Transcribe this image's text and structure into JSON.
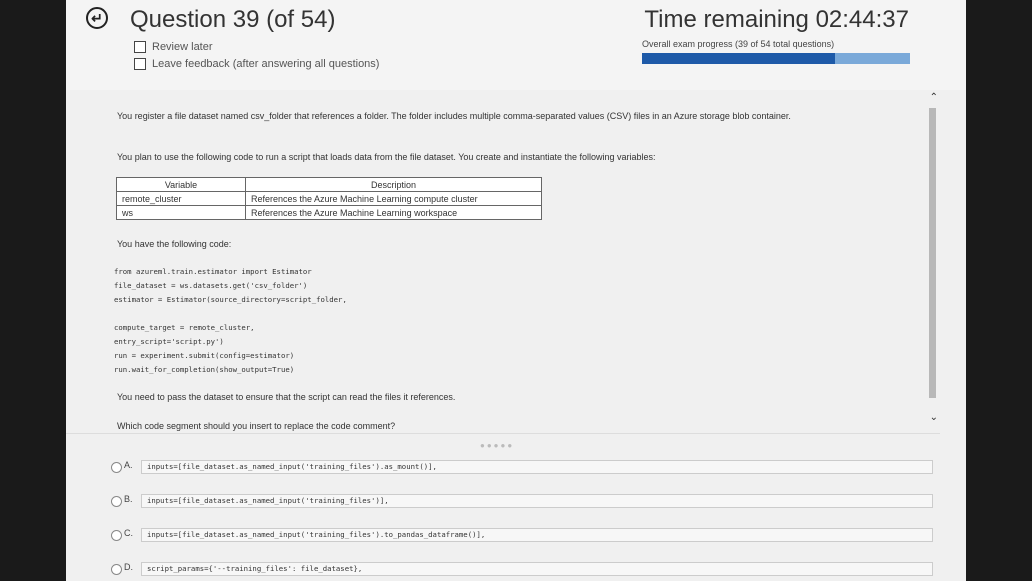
{
  "header": {
    "question_title": "Question 39 (of 54)",
    "review_later": "Review later",
    "leave_feedback": "Leave feedback (after answering all questions)",
    "timer": "Time remaining 02:44:37",
    "progress_label": "Overall exam progress (39 of 54 total questions)",
    "progress_fraction": 0.722
  },
  "question": {
    "para1": "You register a file dataset named csv_folder that references a folder. The folder includes multiple comma-separated values (CSV) files in an Azure storage blob container.",
    "para2": "You plan to use the following code to run a script that loads data from the file dataset. You create and instantiate the following variables:",
    "table": {
      "headers": [
        "Variable",
        "Description"
      ],
      "rows": [
        [
          "remote_cluster",
          "References the Azure Machine Learning compute cluster"
        ],
        [
          "ws",
          "References the Azure Machine Learning workspace"
        ]
      ]
    },
    "para3": "You have the following code:",
    "code_block1": "from azureml.train.estimator import Estimator\nfile_dataset = ws.datasets.get('csv_folder')\nestimator = Estimator(source_directory=script_folder,",
    "code_block2": "compute_target = remote_cluster,\nentry_script='script.py')\nrun = experiment.submit(config=estimator)\nrun.wait_for_completion(show_output=True)",
    "para4": "You need to pass the dataset to ensure that the script can read the files it references.",
    "para5": "Which code segment should you insert to replace the code comment?"
  },
  "options": [
    {
      "letter": "A.",
      "code": "inputs=[file_dataset.as_named_input('training_files').as_mount()],"
    },
    {
      "letter": "B.",
      "code": "inputs=[file_dataset.as_named_input('training_files')],"
    },
    {
      "letter": "C.",
      "code": "inputs=[file_dataset.as_named_input('training_files').to_pandas_dataframe()],"
    },
    {
      "letter": "D.",
      "code": "script_params={'--training_files': file_dataset},"
    }
  ],
  "colors": {
    "progress_fill": "#1e5aa8",
    "progress_track": "#7aa9d9"
  },
  "icons": {
    "back": "back-circle-icon",
    "scroll_up": "chevron-up-icon",
    "scroll_down": "chevron-down-icon"
  }
}
